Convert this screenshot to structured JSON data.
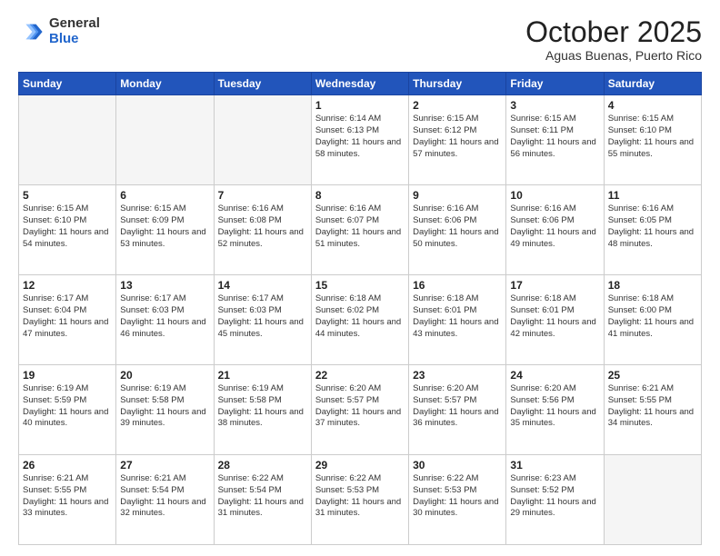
{
  "header": {
    "logo_general": "General",
    "logo_blue": "Blue",
    "month_title": "October 2025",
    "subtitle": "Aguas Buenas, Puerto Rico"
  },
  "weekdays": [
    "Sunday",
    "Monday",
    "Tuesday",
    "Wednesday",
    "Thursday",
    "Friday",
    "Saturday"
  ],
  "weeks": [
    [
      {
        "day": "",
        "empty": true
      },
      {
        "day": "",
        "empty": true
      },
      {
        "day": "",
        "empty": true
      },
      {
        "day": "1",
        "sunrise": "6:14 AM",
        "sunset": "6:13 PM",
        "daylight": "11 hours and 58 minutes."
      },
      {
        "day": "2",
        "sunrise": "6:15 AM",
        "sunset": "6:12 PM",
        "daylight": "11 hours and 57 minutes."
      },
      {
        "day": "3",
        "sunrise": "6:15 AM",
        "sunset": "6:11 PM",
        "daylight": "11 hours and 56 minutes."
      },
      {
        "day": "4",
        "sunrise": "6:15 AM",
        "sunset": "6:10 PM",
        "daylight": "11 hours and 55 minutes."
      }
    ],
    [
      {
        "day": "5",
        "sunrise": "6:15 AM",
        "sunset": "6:10 PM",
        "daylight": "11 hours and 54 minutes."
      },
      {
        "day": "6",
        "sunrise": "6:15 AM",
        "sunset": "6:09 PM",
        "daylight": "11 hours and 53 minutes."
      },
      {
        "day": "7",
        "sunrise": "6:16 AM",
        "sunset": "6:08 PM",
        "daylight": "11 hours and 52 minutes."
      },
      {
        "day": "8",
        "sunrise": "6:16 AM",
        "sunset": "6:07 PM",
        "daylight": "11 hours and 51 minutes."
      },
      {
        "day": "9",
        "sunrise": "6:16 AM",
        "sunset": "6:06 PM",
        "daylight": "11 hours and 50 minutes."
      },
      {
        "day": "10",
        "sunrise": "6:16 AM",
        "sunset": "6:06 PM",
        "daylight": "11 hours and 49 minutes."
      },
      {
        "day": "11",
        "sunrise": "6:16 AM",
        "sunset": "6:05 PM",
        "daylight": "11 hours and 48 minutes."
      }
    ],
    [
      {
        "day": "12",
        "sunrise": "6:17 AM",
        "sunset": "6:04 PM",
        "daylight": "11 hours and 47 minutes."
      },
      {
        "day": "13",
        "sunrise": "6:17 AM",
        "sunset": "6:03 PM",
        "daylight": "11 hours and 46 minutes."
      },
      {
        "day": "14",
        "sunrise": "6:17 AM",
        "sunset": "6:03 PM",
        "daylight": "11 hours and 45 minutes."
      },
      {
        "day": "15",
        "sunrise": "6:18 AM",
        "sunset": "6:02 PM",
        "daylight": "11 hours and 44 minutes."
      },
      {
        "day": "16",
        "sunrise": "6:18 AM",
        "sunset": "6:01 PM",
        "daylight": "11 hours and 43 minutes."
      },
      {
        "day": "17",
        "sunrise": "6:18 AM",
        "sunset": "6:01 PM",
        "daylight": "11 hours and 42 minutes."
      },
      {
        "day": "18",
        "sunrise": "6:18 AM",
        "sunset": "6:00 PM",
        "daylight": "11 hours and 41 minutes."
      }
    ],
    [
      {
        "day": "19",
        "sunrise": "6:19 AM",
        "sunset": "5:59 PM",
        "daylight": "11 hours and 40 minutes."
      },
      {
        "day": "20",
        "sunrise": "6:19 AM",
        "sunset": "5:58 PM",
        "daylight": "11 hours and 39 minutes."
      },
      {
        "day": "21",
        "sunrise": "6:19 AM",
        "sunset": "5:58 PM",
        "daylight": "11 hours and 38 minutes."
      },
      {
        "day": "22",
        "sunrise": "6:20 AM",
        "sunset": "5:57 PM",
        "daylight": "11 hours and 37 minutes."
      },
      {
        "day": "23",
        "sunrise": "6:20 AM",
        "sunset": "5:57 PM",
        "daylight": "11 hours and 36 minutes."
      },
      {
        "day": "24",
        "sunrise": "6:20 AM",
        "sunset": "5:56 PM",
        "daylight": "11 hours and 35 minutes."
      },
      {
        "day": "25",
        "sunrise": "6:21 AM",
        "sunset": "5:55 PM",
        "daylight": "11 hours and 34 minutes."
      }
    ],
    [
      {
        "day": "26",
        "sunrise": "6:21 AM",
        "sunset": "5:55 PM",
        "daylight": "11 hours and 33 minutes."
      },
      {
        "day": "27",
        "sunrise": "6:21 AM",
        "sunset": "5:54 PM",
        "daylight": "11 hours and 32 minutes."
      },
      {
        "day": "28",
        "sunrise": "6:22 AM",
        "sunset": "5:54 PM",
        "daylight": "11 hours and 31 minutes."
      },
      {
        "day": "29",
        "sunrise": "6:22 AM",
        "sunset": "5:53 PM",
        "daylight": "11 hours and 31 minutes."
      },
      {
        "day": "30",
        "sunrise": "6:22 AM",
        "sunset": "5:53 PM",
        "daylight": "11 hours and 30 minutes."
      },
      {
        "day": "31",
        "sunrise": "6:23 AM",
        "sunset": "5:52 PM",
        "daylight": "11 hours and 29 minutes."
      },
      {
        "day": "",
        "empty": true
      }
    ]
  ]
}
